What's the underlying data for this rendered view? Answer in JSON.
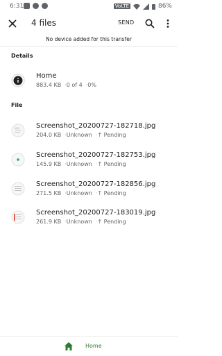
{
  "status_bar": {
    "time": "6:31",
    "battery": "86%",
    "network_tag": "VoLTE"
  },
  "toolbar": {
    "title": "4 files",
    "send_label": "SEND"
  },
  "subtitle": "No device added for this transfer",
  "details": {
    "header": "Details",
    "folder": {
      "name": "Home",
      "size": "883.4 KB",
      "progress": "0 of 4",
      "percent": "0%"
    }
  },
  "files": {
    "header": "File",
    "items": [
      {
        "name": "Screenshot_20200727-182718.jpg",
        "size": "204.0 KB",
        "device": "Unknown",
        "status": "↑ Pending"
      },
      {
        "name": "Screenshot_20200727-182753.jpg",
        "size": "145.9 KB",
        "device": "Unknown",
        "status": "↑ Pending"
      },
      {
        "name": "Screenshot_20200727-182856.jpg",
        "size": "271.5 KB",
        "device": "Unknown",
        "status": "↑ Pending"
      },
      {
        "name": "Screenshot_20200727-183019.jpg",
        "size": "261.9 KB",
        "device": "Unknown",
        "status": "↑ Pending"
      }
    ]
  },
  "bottom_nav": {
    "home_label": "Home"
  },
  "colors": {
    "accent_green": "#2e7d32",
    "text_primary": "#202124",
    "text_secondary": "#5f6368"
  },
  "icons": [
    "close-icon",
    "search-icon",
    "more-vert-icon",
    "info-icon",
    "image-thumbnail-icon",
    "home-icon"
  ]
}
